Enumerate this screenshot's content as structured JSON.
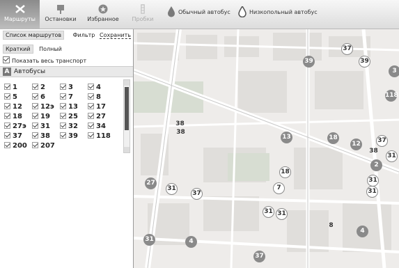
{
  "topbar": {
    "tabs": [
      {
        "label": "Маршруты",
        "icon": "route-icon"
      },
      {
        "label": "Остановки",
        "icon": "stop-sign-icon"
      },
      {
        "label": "Избранное",
        "icon": "star-icon"
      },
      {
        "label": "Пробки",
        "icon": "traffic-light-icon"
      }
    ],
    "legend": {
      "regular": "Обычный автобус",
      "lowfloor": "Низкопольный автобус"
    }
  },
  "panel": {
    "list_label": "Список маршрутов",
    "filter_label": "Фильтр",
    "save_label": "Сохранить",
    "view_short": "Краткий",
    "view_full": "Полный",
    "show_all": "Показать весь транспорт",
    "section_letter": "А",
    "section_title": "Автобусы",
    "routes": [
      "1",
      "2",
      "3",
      "4",
      "5",
      "6",
      "7",
      "8",
      "12",
      "12э",
      "13",
      "17",
      "18",
      "19",
      "25",
      "27",
      "27э",
      "31",
      "32",
      "34",
      "37",
      "38",
      "39",
      "118",
      "200",
      "207"
    ]
  },
  "map": {
    "markers": [
      {
        "n": "37",
        "k": "lt"
      },
      {
        "n": "39",
        "k": "dark"
      },
      {
        "n": "39",
        "k": "lt"
      },
      {
        "n": "3",
        "k": "dark"
      },
      {
        "n": "118",
        "k": "dark"
      },
      {
        "n": "38",
        "k": "plain"
      },
      {
        "n": "38",
        "k": "plain"
      },
      {
        "n": "13",
        "k": "dark"
      },
      {
        "n": "18",
        "k": "dark"
      },
      {
        "n": "12",
        "k": "dark"
      },
      {
        "n": "37",
        "k": "lt"
      },
      {
        "n": "38",
        "k": "plain"
      },
      {
        "n": "31",
        "k": "lt"
      },
      {
        "n": "2",
        "k": "dark"
      },
      {
        "n": "18",
        "k": "lt"
      },
      {
        "n": "27",
        "k": "dark"
      },
      {
        "n": "31",
        "k": "lt"
      },
      {
        "n": "37",
        "k": "lt"
      },
      {
        "n": "7",
        "k": "lt"
      },
      {
        "n": "31",
        "k": "lt"
      },
      {
        "n": "31",
        "k": "lt"
      },
      {
        "n": "31",
        "k": "lt"
      },
      {
        "n": "31",
        "k": "lt"
      },
      {
        "n": "8",
        "k": "plain"
      },
      {
        "n": "4",
        "k": "dark"
      },
      {
        "n": "31",
        "k": "dark"
      },
      {
        "n": "4",
        "k": "dark"
      },
      {
        "n": "37",
        "k": "dark"
      }
    ]
  }
}
